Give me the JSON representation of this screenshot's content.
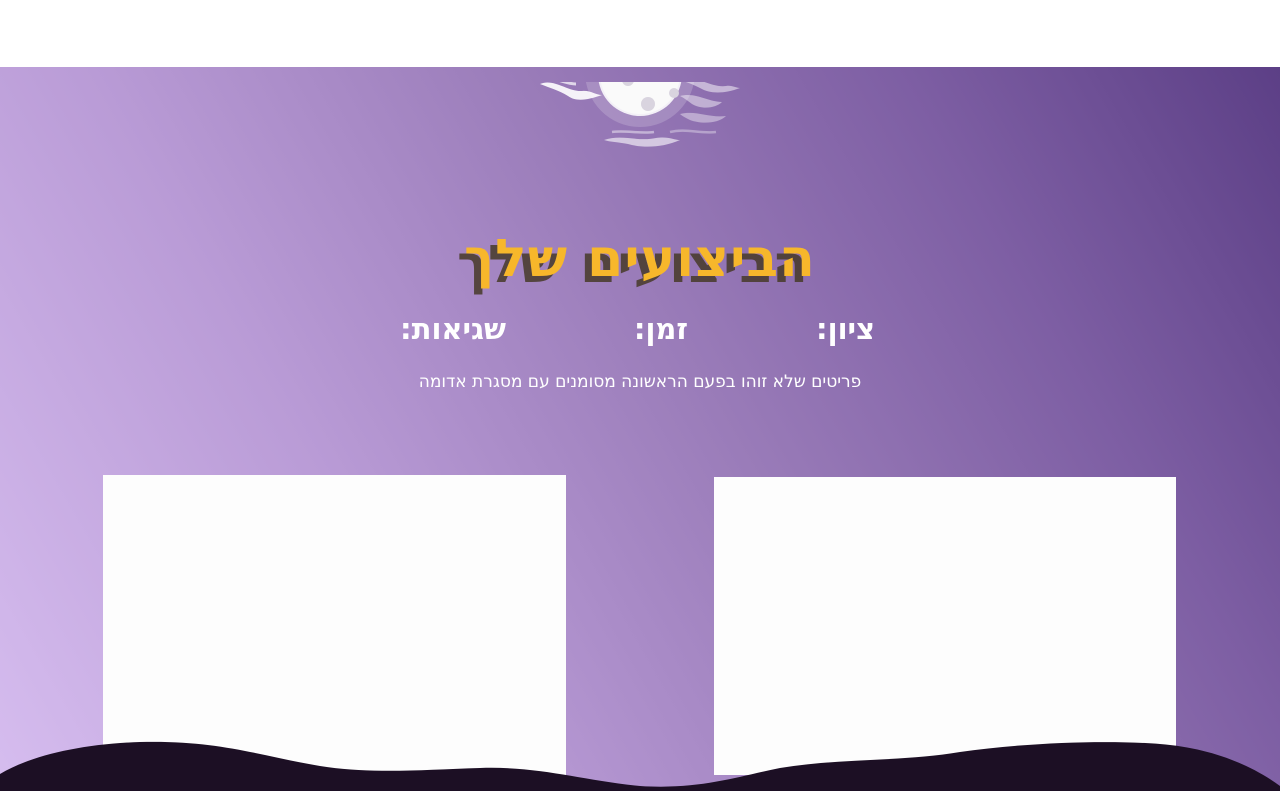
{
  "header": {
    "title": "הביצועים שלך"
  },
  "stats": {
    "score_label": "ציון:",
    "time_label": "זמן:",
    "errors_label": "שגיאות:"
  },
  "note": {
    "text": "פריטים שלא זוהו בפעם הראשונה מסומנים עם מסגרת אדומה"
  },
  "colors": {
    "title": "#f7b72b",
    "title_shadow": "#463a28",
    "gradient_light": "#d6bdef",
    "gradient_dark": "#5c3f86",
    "ground": "#1c0f24",
    "card": "#fdfdfd"
  },
  "icons": {
    "moon": "moon-icon",
    "clouds": "cloud-icon"
  }
}
